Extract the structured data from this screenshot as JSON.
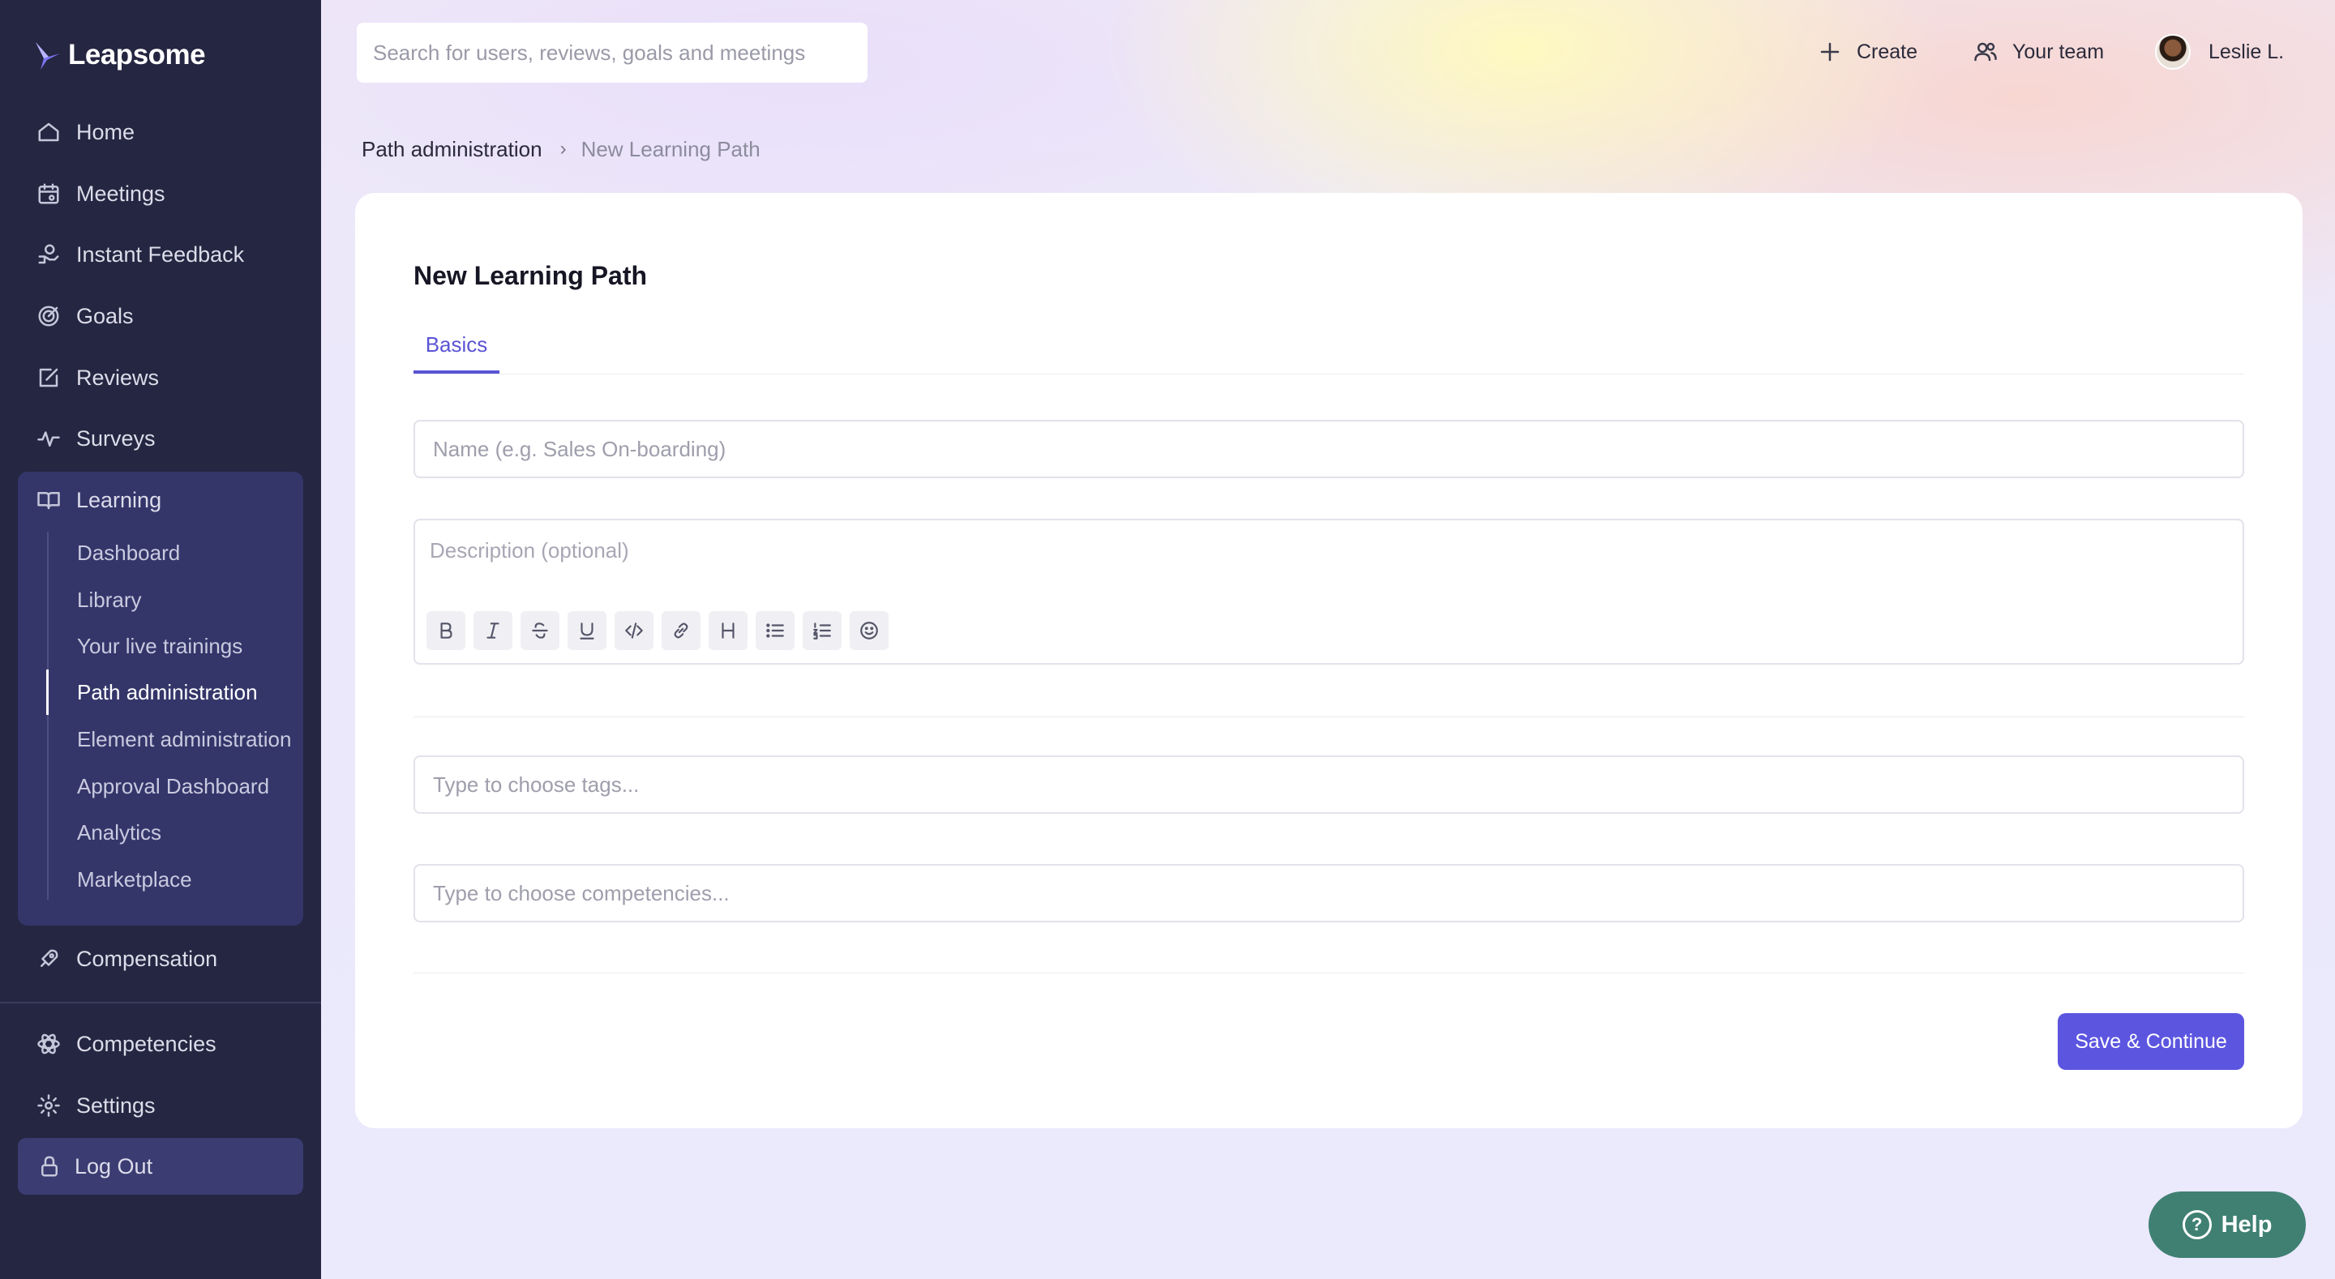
{
  "brand": {
    "name": "Leapsome"
  },
  "sidebar": {
    "items": [
      {
        "label": "Home",
        "icon": "home-icon"
      },
      {
        "label": "Meetings",
        "icon": "calendar-icon"
      },
      {
        "label": "Instant Feedback",
        "icon": "hand-icon"
      },
      {
        "label": "Goals",
        "icon": "target-icon"
      },
      {
        "label": "Reviews",
        "icon": "edit-icon"
      },
      {
        "label": "Surveys",
        "icon": "pulse-icon"
      },
      {
        "label": "Learning",
        "icon": "book-icon"
      }
    ],
    "learning_sub": [
      "Dashboard",
      "Library",
      "Your live trainings",
      "Path administration",
      "Element administration",
      "Approval Dashboard",
      "Analytics",
      "Marketplace"
    ],
    "bottom_items": [
      {
        "label": "Compensation",
        "icon": "rocket-icon"
      },
      {
        "label": "Competencies",
        "icon": "atom-icon"
      },
      {
        "label": "Settings",
        "icon": "gear-icon"
      }
    ],
    "logout": "Log Out"
  },
  "header": {
    "search_placeholder": "Search for users, reviews, goals and meetings",
    "create_label": "Create",
    "team_label": "Your team",
    "user_name": "Leslie L."
  },
  "breadcrumb": {
    "parent": "Path administration",
    "current": "New Learning Path"
  },
  "form": {
    "title": "New Learning Path",
    "tab": "Basics",
    "name_placeholder": "Name (e.g. Sales On-boarding)",
    "description_placeholder": "Description (optional)",
    "tags_placeholder": "Type to choose tags...",
    "competencies_placeholder": "Type to choose competencies...",
    "save_label": "Save & Continue"
  },
  "help": {
    "label": "Help"
  },
  "colors": {
    "sidebar_bg": "#252641",
    "accent": "#5c55e0",
    "help_bg": "#3f8073"
  }
}
